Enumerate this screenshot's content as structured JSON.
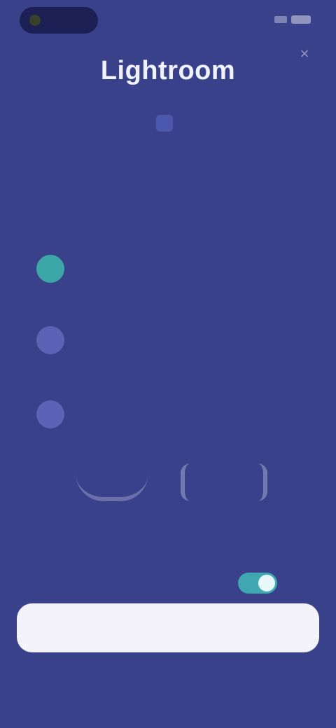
{
  "status_bar": {
    "time": ""
  },
  "header": {
    "brand": "Lightroom",
    "close": "×"
  },
  "subtitle": {
    "text": ""
  },
  "headline": "",
  "features": [
    {
      "title": "",
      "desc": ""
    },
    {
      "title": "",
      "desc": ""
    },
    {
      "title": "",
      "desc": ""
    }
  ],
  "proof": {
    "rating_text": ""
  },
  "note": "",
  "toggle": {
    "label": "",
    "on": true
  },
  "cta": {
    "label": ""
  },
  "footer": {
    "line1": "",
    "line2": ""
  },
  "colors": {
    "background": "#39418a",
    "accent": "#3fa7b1",
    "cta_bg": "#f3f2f8"
  }
}
